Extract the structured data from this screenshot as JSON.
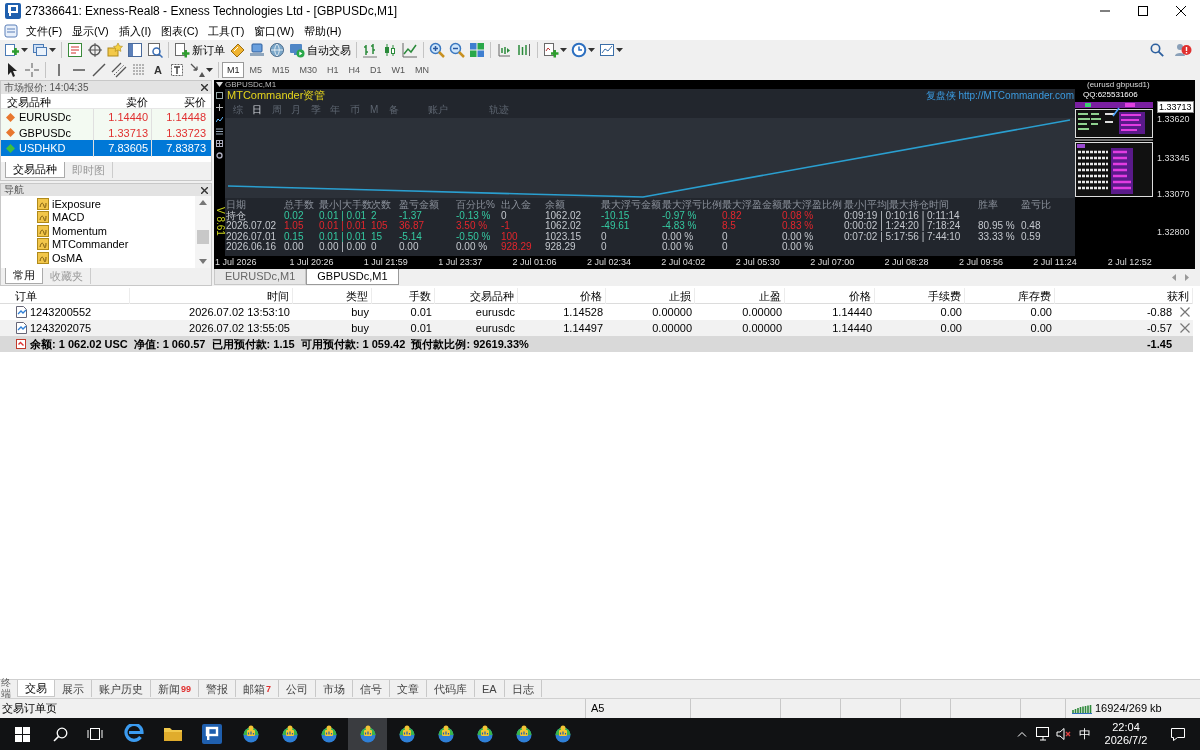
{
  "window": {
    "title": "27336641: Exness-Real8 - Exness Technologies Ltd - [GBPUSDc,M1]"
  },
  "menu": [
    "文件(F)",
    "显示(V)",
    "插入(I)",
    "图表(C)",
    "工具(T)",
    "窗口(W)",
    "帮助(H)"
  ],
  "toolbar": {
    "new_order": "新订单",
    "auto_trading": "自动交易",
    "text_tool": "A"
  },
  "timeframes": [
    {
      "label": "M1",
      "selected": true
    },
    {
      "label": "M5",
      "selected": false
    },
    {
      "label": "M15",
      "selected": false
    },
    {
      "label": "M30",
      "selected": false
    },
    {
      "label": "H1",
      "selected": false
    },
    {
      "label": "H4",
      "selected": false
    },
    {
      "label": "D1",
      "selected": false
    },
    {
      "label": "W1",
      "selected": false
    },
    {
      "label": "MN",
      "selected": false
    }
  ],
  "market_watch": {
    "title": "市场报价: 14:04:35",
    "columns": [
      "交易品种",
      "卖价",
      "买价"
    ],
    "rows": [
      {
        "symbol": "EURUSDc",
        "bid": "1.14440",
        "ask": "1.14448",
        "color": "#e8772e",
        "falling": true,
        "selected": false
      },
      {
        "symbol": "GBPUSDc",
        "bid": "1.33713",
        "ask": "1.33723",
        "color": "#e8772e",
        "falling": true,
        "selected": false
      },
      {
        "symbol": "USDHKD",
        "bid": "7.83605",
        "ask": "7.83873",
        "color": "#3fbf3f",
        "falling": false,
        "selected": true
      }
    ],
    "tabs": [
      {
        "label": "交易品种",
        "selected": true
      },
      {
        "label": "即时图",
        "selected": false
      }
    ]
  },
  "navigator": {
    "title": "导航",
    "items": [
      "iExposure",
      "MACD",
      "Momentum",
      "MTCommander",
      "OsMA"
    ],
    "tabs": [
      {
        "label": "常用",
        "selected": true
      },
      {
        "label": "收藏夹",
        "selected": false
      }
    ]
  },
  "chart": {
    "header": "GBPUSDc,M1",
    "version": "V 8.61",
    "panel": {
      "title": "MTCommander资管",
      "link": "复盘侠 http://MTCommander.com",
      "period_tabs": [
        {
          "label": "综",
          "selected": false
        },
        {
          "label": "日",
          "selected": true
        },
        {
          "label": "周",
          "selected": false
        },
        {
          "label": "月",
          "selected": false
        },
        {
          "label": "季",
          "selected": false
        },
        {
          "label": "年",
          "selected": false
        },
        {
          "label": "币",
          "selected": false
        },
        {
          "label": "M",
          "selected": false
        },
        {
          "label": "备",
          "selected": false
        }
      ],
      "view_tabs": [
        {
          "label": "账户",
          "selected": false
        },
        {
          "label": "轨迹",
          "selected": false
        }
      ],
      "stats": {
        "columns": [
          "日期",
          "总手数",
          "最小|大手数",
          "次数",
          "盈亏金额",
          "百分比%",
          "出入金",
          "余额",
          "最大浮亏金额",
          "最大浮亏比例",
          "最大浮盈金额",
          "最大浮盈比例",
          "最小|平均|最大持仓时间",
          "胜率",
          "盈亏比"
        ],
        "rows": [
          {
            "cells": [
              {
                "text": "持仓",
                "kind": "plain"
              },
              {
                "text": "0.02",
                "kind": "loss"
              },
              {
                "text": "0.01 | 0.01",
                "kind": "loss"
              },
              {
                "text": "2",
                "kind": "loss"
              },
              {
                "text": "-1.37",
                "kind": "loss"
              },
              {
                "text": "-0.13 %",
                "kind": "loss"
              },
              {
                "text": "0",
                "kind": "plain"
              },
              {
                "text": "1062.02",
                "kind": "plain"
              },
              {
                "text": "-10.15",
                "kind": "loss"
              },
              {
                "text": "-0.97 %",
                "kind": "loss"
              },
              {
                "text": "0.82",
                "kind": "gain"
              },
              {
                "text": "0.08 %",
                "kind": "gain"
              },
              {
                "text": "0:09:19 | 0:10:16 | 0:11:14",
                "kind": "plain"
              }
            ]
          },
          {
            "cells": [
              {
                "text": "2026.07.02",
                "kind": "plain"
              },
              {
                "text": "1.05",
                "kind": "gain"
              },
              {
                "text": "0.01 | 0.01",
                "kind": "gain"
              },
              {
                "text": "105",
                "kind": "gain"
              },
              {
                "text": "36.87",
                "kind": "gain"
              },
              {
                "text": "3.50 %",
                "kind": "gain"
              },
              {
                "text": "-1",
                "kind": "gain"
              },
              {
                "text": "1062.02",
                "kind": "plain"
              },
              {
                "text": "-49.61",
                "kind": "loss"
              },
              {
                "text": "-4.83 %",
                "kind": "loss"
              },
              {
                "text": "8.5",
                "kind": "gain"
              },
              {
                "text": "0.83 %",
                "kind": "gain"
              },
              {
                "text": "0:00:02 | 1:24:20 | 7:18:24",
                "kind": "plain"
              },
              {
                "text": "80.95 %",
                "kind": "plain"
              },
              {
                "text": "0.48",
                "kind": "plain"
              }
            ]
          },
          {
            "cells": [
              {
                "text": "2026.07.01",
                "kind": "plain"
              },
              {
                "text": "0.15",
                "kind": "loss"
              },
              {
                "text": "0.01 | 0.01",
                "kind": "loss"
              },
              {
                "text": "15",
                "kind": "loss"
              },
              {
                "text": "-5.14",
                "kind": "loss"
              },
              {
                "text": "-0.50 %",
                "kind": "loss"
              },
              {
                "text": "100",
                "kind": "gain"
              },
              {
                "text": "1023.15",
                "kind": "plain"
              },
              {
                "text": "0",
                "kind": "plain"
              },
              {
                "text": "0.00 %",
                "kind": "plain"
              },
              {
                "text": "0",
                "kind": "plain"
              },
              {
                "text": "0.00 %",
                "kind": "plain"
              },
              {
                "text": "0:07:02 | 5:17:56 | 7:44:10",
                "kind": "plain"
              },
              {
                "text": "33.33 %",
                "kind": "plain"
              },
              {
                "text": "0.59",
                "kind": "plain"
              }
            ]
          },
          {
            "cells": [
              {
                "text": "2026.06.16",
                "kind": "plain"
              },
              {
                "text": "0.00",
                "kind": "plain"
              },
              {
                "text": "0.00 | 0.00",
                "kind": "plain"
              },
              {
                "text": "0",
                "kind": "plain"
              },
              {
                "text": "0.00",
                "kind": "plain"
              },
              {
                "text": "0.00 %",
                "kind": "plain"
              },
              {
                "text": "928.29",
                "kind": "gain"
              },
              {
                "text": "928.29",
                "kind": "plain"
              },
              {
                "text": "0",
                "kind": "plain"
              },
              {
                "text": "0.00 %",
                "kind": "plain"
              },
              {
                "text": "0",
                "kind": "plain"
              },
              {
                "text": "0.00 %",
                "kind": "plain"
              }
            ]
          }
        ]
      }
    },
    "overlay": {
      "label": "(eurusd gbpusd1)",
      "contact": "QQ:625531606"
    },
    "price_scale": [
      {
        "label": "1.33713",
        "kind": "current"
      },
      {
        "label": "1.33620",
        "kind": "tick"
      },
      {
        "label": "1.33345",
        "kind": "tick"
      },
      {
        "label": "1.33070",
        "kind": "tick"
      },
      {
        "label": "1.32800",
        "kind": "tick"
      }
    ],
    "time_axis": [
      "1 Jul 2026",
      "1 Jul 20:26",
      "1 Jul 21:59",
      "1 Jul 23:37",
      "2 Jul 01:06",
      "2 Jul 02:34",
      "2 Jul 04:02",
      "2 Jul 05:30",
      "2 Jul 07:00",
      "2 Jul 08:28",
      "2 Jul 09:56",
      "2 Jul 11:24",
      "2 Jul 12:52"
    ]
  },
  "chart_tabs": [
    {
      "label": "EURUSDc,M1",
      "selected": false
    },
    {
      "label": "GBPUSDc,M1",
      "selected": true
    }
  ],
  "terminal": {
    "columns": [
      "订单",
      "时间",
      "类型",
      "手数",
      "交易品种",
      "价格",
      "止损",
      "止盈",
      "价格",
      "手续费",
      "库存费",
      "获利"
    ],
    "rows": [
      {
        "cells": [
          "1243200552",
          "2026.07.02 13:53:10",
          "buy",
          "0.01",
          "eurusdc",
          "1.14528",
          "0.00000",
          "0.00000",
          "1.14440",
          "0.00",
          "0.00",
          "-0.88"
        ]
      },
      {
        "cells": [
          "1243202075",
          "2026.07.02 13:55:05",
          "buy",
          "0.01",
          "eurusdc",
          "1.14497",
          "0.00000",
          "0.00000",
          "1.14440",
          "0.00",
          "0.00",
          "-0.57"
        ]
      }
    ],
    "summary": {
      "text": "余额: 1 062.02 USC  净值: 1 060.57  已用预付款: 1.15  可用预付款: 1 059.42  预付款比例: 92619.33%",
      "profit": "-1.45"
    },
    "side_label": "终端",
    "tabs": [
      {
        "label": "交易",
        "selected": true
      },
      {
        "label": "展示",
        "selected": false
      },
      {
        "label": "账户历史",
        "selected": false
      },
      {
        "label": "新闻",
        "count": "99",
        "selected": false
      },
      {
        "label": "警报",
        "selected": false
      },
      {
        "label": "邮箱",
        "count": "7",
        "selected": false
      },
      {
        "label": "公司",
        "selected": false
      },
      {
        "label": "市场",
        "selected": false
      },
      {
        "label": "信号",
        "selected": false
      },
      {
        "label": "文章",
        "selected": false
      },
      {
        "label": "代码库",
        "selected": false
      },
      {
        "label": "EA",
        "selected": false
      },
      {
        "label": "日志",
        "selected": false
      }
    ]
  },
  "status_bar": {
    "hint": "交易订单页",
    "profile": "A5",
    "traffic": "16924/269 kb"
  },
  "taskbar": {
    "apps": [
      {
        "kind": "browser",
        "selected": false
      },
      {
        "kind": "folder",
        "selected": false
      },
      {
        "kind": "editor",
        "selected": false
      },
      {
        "kind": "terminal",
        "selected": false
      },
      {
        "kind": "terminal",
        "selected": false
      },
      {
        "kind": "terminal",
        "selected": false
      },
      {
        "kind": "terminal",
        "selected": true
      },
      {
        "kind": "terminal",
        "selected": false
      },
      {
        "kind": "terminal",
        "selected": false
      },
      {
        "kind": "terminal",
        "selected": false
      },
      {
        "kind": "terminal",
        "selected": false
      },
      {
        "kind": "terminal",
        "selected": false
      }
    ],
    "ime": "中",
    "time": "22:04",
    "date": "2026/7/2"
  }
}
